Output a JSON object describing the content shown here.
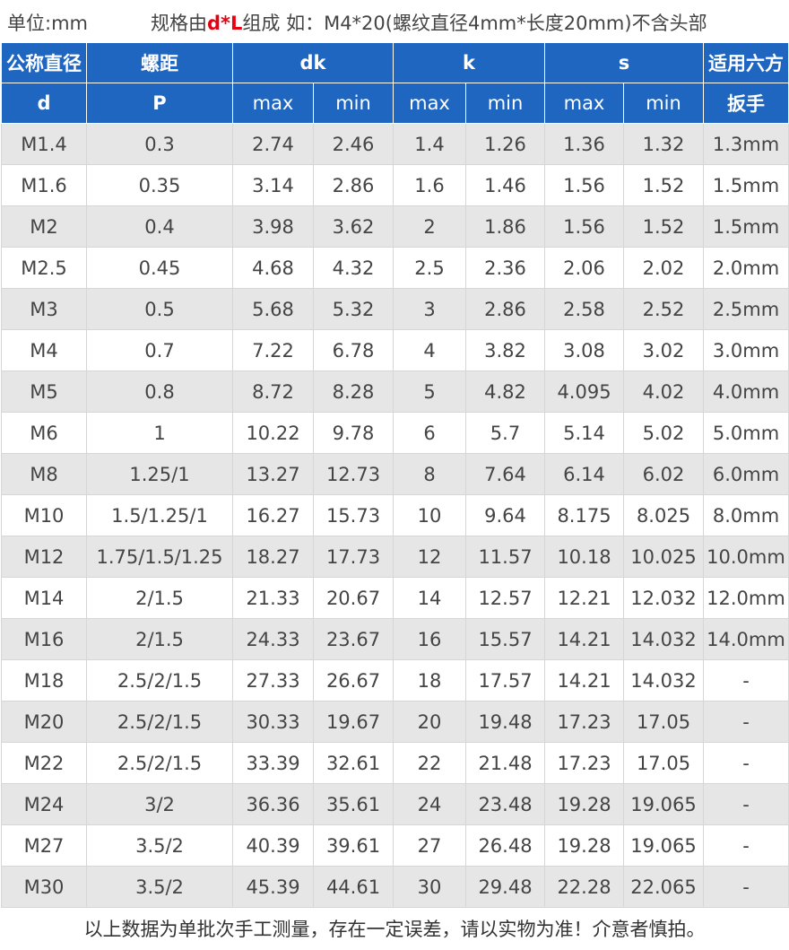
{
  "header": {
    "unit_text": "单位:mm",
    "spec_prefix": "规格由",
    "spec_highlight": "d*L",
    "spec_suffix": "组成 如：M4*20(螺纹直径4mm*长度20mm)不含头部"
  },
  "colors": {
    "header_bg": "#1f66c1",
    "highlight": "#e60012",
    "row_alt": "#e6e6e6"
  },
  "table": {
    "headers": {
      "d_line1": "公称直径",
      "d_line2": "d",
      "p_line1": "螺距",
      "p_line2": "P",
      "dk": "dk",
      "k": "k",
      "s": "s",
      "hex_line1": "适用六方",
      "hex_line2": "扳手",
      "max": "max",
      "min": "min"
    },
    "rows": [
      [
        "M1.4",
        "0.3",
        "2.74",
        "2.46",
        "1.4",
        "1.26",
        "1.36",
        "1.32",
        "1.3mm"
      ],
      [
        "M1.6",
        "0.35",
        "3.14",
        "2.86",
        "1.6",
        "1.46",
        "1.56",
        "1.52",
        "1.5mm"
      ],
      [
        "M2",
        "0.4",
        "3.98",
        "3.62",
        "2",
        "1.86",
        "1.56",
        "1.52",
        "1.5mm"
      ],
      [
        "M2.5",
        "0.45",
        "4.68",
        "4.32",
        "2.5",
        "2.36",
        "2.06",
        "2.02",
        "2.0mm"
      ],
      [
        "M3",
        "0.5",
        "5.68",
        "5.32",
        "3",
        "2.86",
        "2.58",
        "2.52",
        "2.5mm"
      ],
      [
        "M4",
        "0.7",
        "7.22",
        "6.78",
        "4",
        "3.82",
        "3.08",
        "3.02",
        "3.0mm"
      ],
      [
        "M5",
        "0.8",
        "8.72",
        "8.28",
        "5",
        "4.82",
        "4.095",
        "4.02",
        "4.0mm"
      ],
      [
        "M6",
        "1",
        "10.22",
        "9.78",
        "6",
        "5.7",
        "5.14",
        "5.02",
        "5.0mm"
      ],
      [
        "M8",
        "1.25/1",
        "13.27",
        "12.73",
        "8",
        "7.64",
        "6.14",
        "6.02",
        "6.0mm"
      ],
      [
        "M10",
        "1.5/1.25/1",
        "16.27",
        "15.73",
        "10",
        "9.64",
        "8.175",
        "8.025",
        "8.0mm"
      ],
      [
        "M12",
        "1.75/1.5/1.25",
        "18.27",
        "17.73",
        "12",
        "11.57",
        "10.18",
        "10.025",
        "10.0mm"
      ],
      [
        "M14",
        "2/1.5",
        "21.33",
        "20.67",
        "14",
        "12.57",
        "12.21",
        "12.032",
        "12.0mm"
      ],
      [
        "M16",
        "2/1.5",
        "24.33",
        "23.67",
        "16",
        "15.57",
        "14.21",
        "14.032",
        "14.0mm"
      ],
      [
        "M18",
        "2.5/2/1.5",
        "27.33",
        "26.67",
        "18",
        "17.57",
        "14.21",
        "14.032",
        "-"
      ],
      [
        "M20",
        "2.5/2/1.5",
        "30.33",
        "19.67",
        "20",
        "19.48",
        "17.23",
        "17.05",
        "-"
      ],
      [
        "M22",
        "2.5/2/1.5",
        "33.39",
        "32.61",
        "22",
        "21.48",
        "17.23",
        "17.05",
        "-"
      ],
      [
        "M24",
        "3/2",
        "36.36",
        "35.61",
        "24",
        "23.48",
        "19.28",
        "19.065",
        "-"
      ],
      [
        "M27",
        "3.5/2",
        "40.39",
        "39.61",
        "27",
        "26.48",
        "19.28",
        "19.065",
        "-"
      ],
      [
        "M30",
        "3.5/2",
        "45.39",
        "44.61",
        "30",
        "29.48",
        "22.28",
        "22.065",
        "-"
      ]
    ]
  },
  "footer": {
    "note": "以上数据为单批次手工测量，存在一定误差，请以实物为准！介意者慎拍。"
  }
}
